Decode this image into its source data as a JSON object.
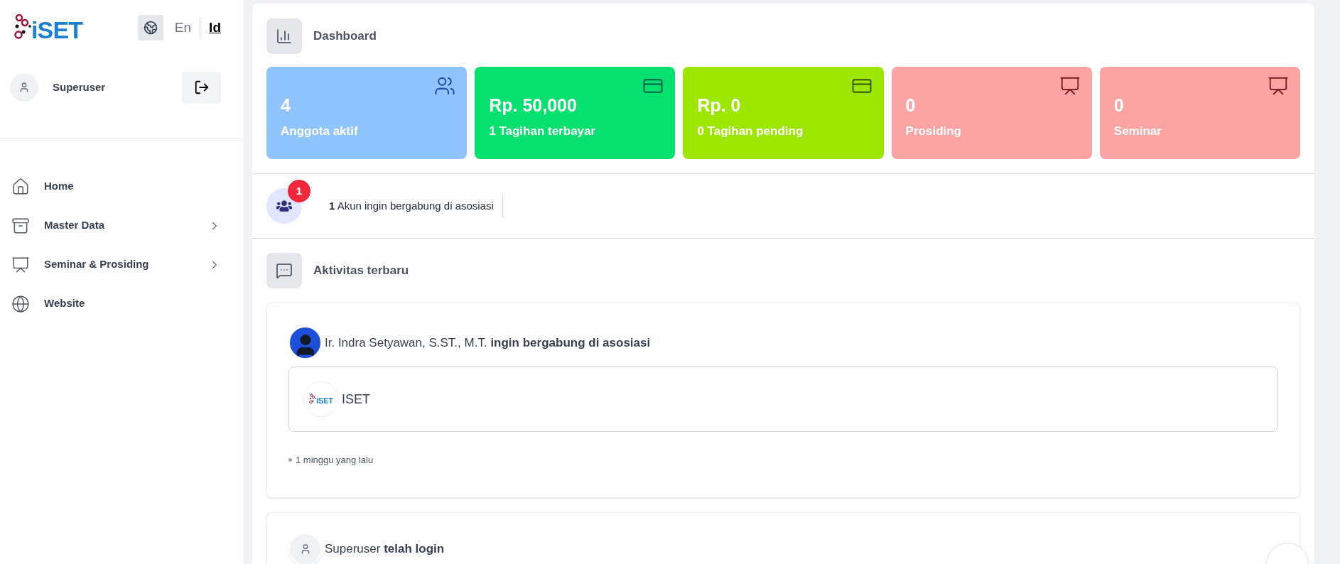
{
  "sidebar": {
    "logo_text": "iSET",
    "languages": [
      {
        "label": "En",
        "selected": false
      },
      {
        "label": "Id",
        "selected": true
      }
    ],
    "user": {
      "name": "Superuser"
    },
    "nav": [
      {
        "label": "Home",
        "has_children": false
      },
      {
        "label": "Master Data",
        "has_children": true
      },
      {
        "label": "Seminar & Prosiding",
        "has_children": true
      },
      {
        "label": "Website",
        "has_children": false
      }
    ]
  },
  "header": {
    "title": "Dashboard"
  },
  "stats": [
    {
      "value": "4",
      "label": "Anggota aktif",
      "color": "#8fc4fd"
    },
    {
      "value": "Rp. 50,000",
      "label": "1 Tagihan terbayar",
      "color": "#06e06f"
    },
    {
      "value": "Rp. 0",
      "label": "0 Tagihan pending",
      "color": "#9de600"
    },
    {
      "value": "0",
      "label": "Prosiding",
      "color": "#fca3a3"
    },
    {
      "value": "0",
      "label": "Seminar",
      "color": "#fca3a3"
    }
  ],
  "notification": {
    "badge": "1",
    "text": "**1** Akun ingin bergabung di asosiasi"
  },
  "activity": {
    "title": "Aktivitas terbaru",
    "items": [
      {
        "kind": "photo",
        "text": "Ir. Indra Setyawan, S.ST., M.T. **ingin bergabung di asosiasi**",
        "org": {
          "logo_text": "iSET",
          "name": "ISET"
        },
        "time": "1 minggu yang lalu"
      },
      {
        "kind": "user",
        "text": "Superuser **telah login**"
      }
    ]
  }
}
